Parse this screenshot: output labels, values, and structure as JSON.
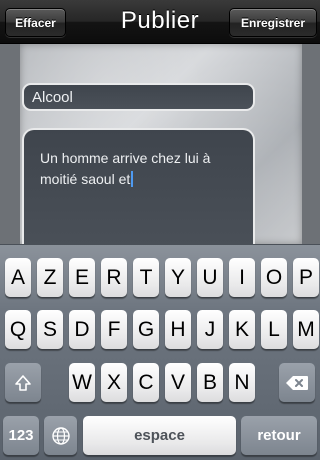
{
  "navbar": {
    "title": "Publier",
    "left_button": "Effacer",
    "right_button": "Enregistrer"
  },
  "form": {
    "title_value": "Alcool",
    "body_value": "Un homme arrive chez lui à moitié saoul et"
  },
  "keyboard": {
    "row1": [
      "A",
      "Z",
      "E",
      "R",
      "T",
      "Y",
      "U",
      "I",
      "O",
      "P"
    ],
    "row2": [
      "Q",
      "S",
      "D",
      "F",
      "G",
      "H",
      "J",
      "K",
      "L",
      "M"
    ],
    "row3": [
      "W",
      "X",
      "C",
      "V",
      "B",
      "N"
    ],
    "numbers_label": "123",
    "space_label": "espace",
    "return_label": "retour",
    "icons": {
      "shift": "shift-icon",
      "delete": "backspace-icon",
      "globe": "globe-icon"
    }
  },
  "colors": {
    "text_field_bg": "#434951",
    "cursor": "#4e9af1"
  }
}
